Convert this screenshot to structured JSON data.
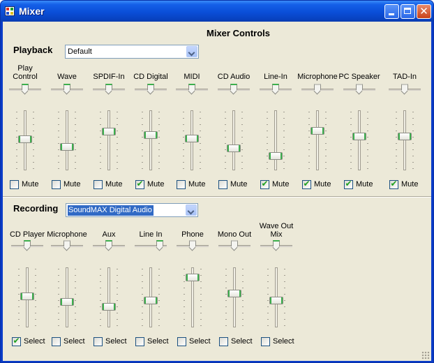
{
  "window": {
    "title": "Mixer"
  },
  "header": {
    "title": "Mixer Controls"
  },
  "playback": {
    "label": "Playback",
    "device": "Default",
    "mute_label": "Mute",
    "channels": [
      {
        "name": "Play\nControl",
        "balance": 0.5,
        "volume": 0.52,
        "muted": false
      },
      {
        "name": "Wave",
        "balance": 0.5,
        "volume": 0.38,
        "muted": false
      },
      {
        "name": "SPDIF-In",
        "balance": 0.5,
        "volume": 0.66,
        "muted": false
      },
      {
        "name": "CD Digital",
        "balance": 0.5,
        "volume": 0.6,
        "muted": true
      },
      {
        "name": "MIDI",
        "balance": 0.5,
        "volume": 0.54,
        "muted": false
      },
      {
        "name": "CD Audio",
        "balance": 0.5,
        "volume": 0.34,
        "muted": false
      },
      {
        "name": "Line-In",
        "balance": 0.5,
        "volume": 0.2,
        "muted": true
      },
      {
        "name": "Microphone",
        "balance": 0.5,
        "volume": 0.68,
        "muted": true,
        "balance_disabled": true
      },
      {
        "name": "PC Speaker",
        "balance": 0.5,
        "volume": 0.58,
        "muted": true,
        "balance_disabled": true
      },
      {
        "name": "TAD-In",
        "balance": 0.5,
        "volume": 0.58,
        "muted": true,
        "balance_disabled": true
      }
    ]
  },
  "recording": {
    "label": "Recording",
    "device": "SoundMAX Digital Audio",
    "select_label": "Select",
    "channels": [
      {
        "name": "CD Player",
        "balance": 0.5,
        "volume": 0.52,
        "selected": true
      },
      {
        "name": "Microphone",
        "balance": 0.5,
        "volume": 0.42,
        "selected": false,
        "balance_disabled": true
      },
      {
        "name": "Aux",
        "balance": 0.5,
        "volume": 0.32,
        "selected": false
      },
      {
        "name": "Line In",
        "balance": 0.85,
        "volume": 0.44,
        "selected": false
      },
      {
        "name": "Phone",
        "balance": 0.5,
        "volume": 0.88,
        "selected": false,
        "balance_disabled": true
      },
      {
        "name": "Mono Out",
        "balance": 0.5,
        "volume": 0.58,
        "selected": false,
        "balance_disabled": true
      },
      {
        "name": "Wave Out\nMix",
        "balance": 0.5,
        "volume": 0.44,
        "selected": false
      }
    ]
  },
  "icons": {
    "app": "mixer-app-icon",
    "minimize": "minimize-icon",
    "maximize": "maximize-icon",
    "close": "close-icon",
    "dropdown": "chevron-down-icon",
    "check": "checkmark-icon"
  },
  "colors": {
    "titlebar": "#0a4ed8",
    "client": "#ece9d8",
    "thumb_accent": "#3cb04c",
    "selection": "#316ac5"
  }
}
